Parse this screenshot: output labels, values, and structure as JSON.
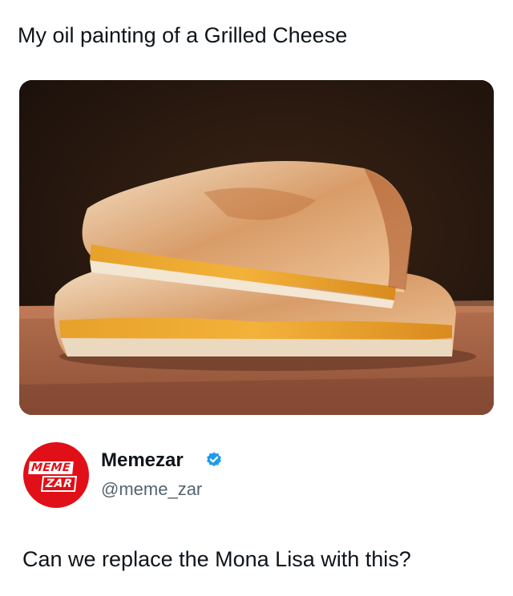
{
  "post": {
    "title": "My oil painting of a Grilled Cheese",
    "image_alt": "Oil painting of a grilled cheese sandwich"
  },
  "tweet": {
    "avatar_logo_line1": "MEME",
    "avatar_logo_line2": "ZAR",
    "display_name": "Memezar",
    "handle": "@meme_zar",
    "verified_icon": "verified-badge-icon",
    "text": "Can we replace the Mona Lisa with this?"
  },
  "colors": {
    "brand_red": "#e10f17",
    "verified_blue": "#1d9bf0",
    "handle_gray": "#536471"
  }
}
